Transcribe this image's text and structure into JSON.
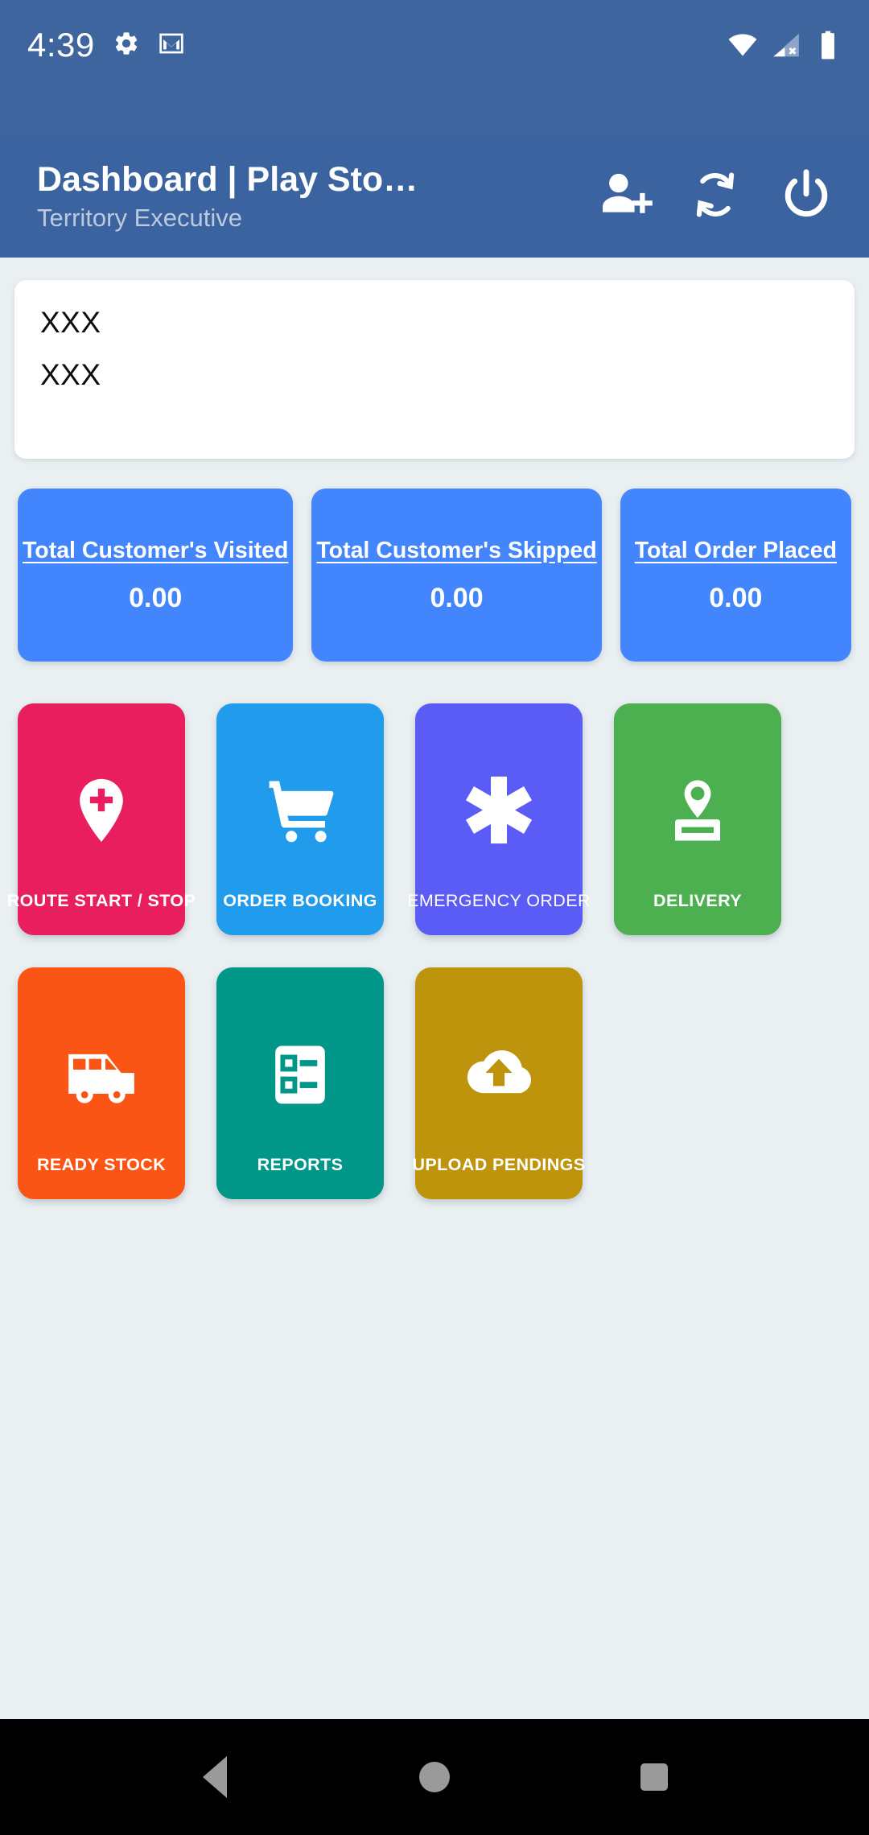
{
  "status_bar": {
    "time": "4:39",
    "icons": [
      "gear-icon",
      "gmail-icon"
    ],
    "right_icons": [
      "wifi-icon",
      "cellular-no-signal-icon",
      "battery-icon"
    ],
    "background_color": "#3F659F"
  },
  "app_bar": {
    "title": "Dashboard | Play Sto…",
    "subtitle": "Territory Executive",
    "background_color": "#3A639F",
    "actions": [
      {
        "name": "add-person-icon",
        "label": "Add Customer"
      },
      {
        "name": "sync-icon",
        "label": "Sync"
      },
      {
        "name": "power-icon",
        "label": "Logout"
      }
    ]
  },
  "info_card": {
    "line1": "XXX",
    "line2": "XXX"
  },
  "stats": [
    {
      "title": "Total Customer's Visited",
      "value": "0.00"
    },
    {
      "title": "Total Customer's Skipped",
      "value": "0.00"
    },
    {
      "title": "Total Order Placed",
      "value": "0.00"
    }
  ],
  "stat_card_color": "#4285FD",
  "tiles": [
    {
      "label": "ROUTE START / STOP",
      "icon": "map-pin-plus-icon",
      "color": "#E91E5F",
      "bold": true
    },
    {
      "label": "ORDER BOOKING",
      "icon": "shopping-cart-icon",
      "color": "#219BEC",
      "bold": true
    },
    {
      "label": "EMERGENCY ORDER",
      "icon": "asterisk-icon",
      "color": "#5A5CF5",
      "bold": false
    },
    {
      "label": "DELIVERY",
      "icon": "delivery-pin-icon",
      "color": "#4CAF50",
      "bold": true
    },
    {
      "label": "READY STOCK",
      "icon": "van-icon",
      "color": "#FA5514",
      "bold": true
    },
    {
      "label": "REPORTS",
      "icon": "report-list-icon",
      "color": "#009688",
      "bold": true
    },
    {
      "label": "UPLOAD PENDINGS",
      "icon": "cloud-upload-icon",
      "color": "#BD940C",
      "bold": true
    }
  ],
  "nav_bar": {
    "back": "back-triangle-icon",
    "home": "home-circle-icon",
    "recents": "recents-square-icon"
  },
  "page_background": "#EAF0F2"
}
